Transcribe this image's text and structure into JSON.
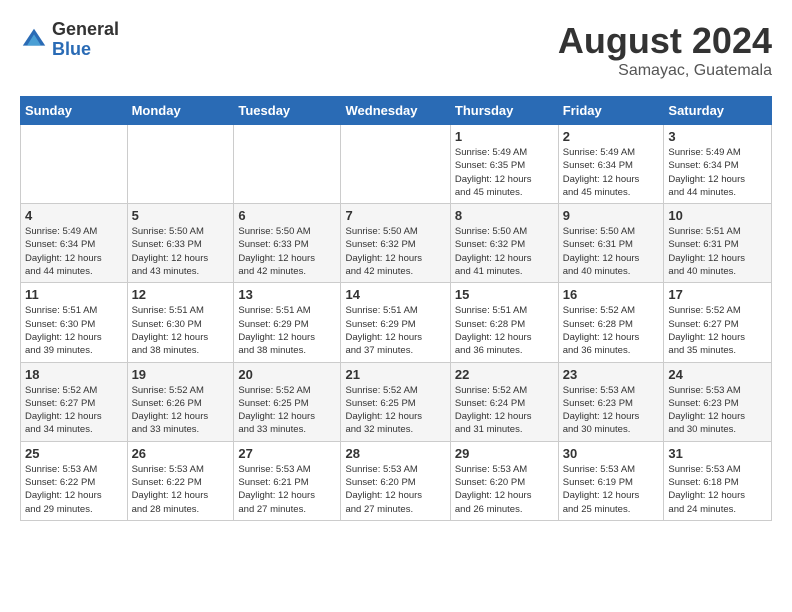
{
  "logo": {
    "general": "General",
    "blue": "Blue"
  },
  "header": {
    "month_year": "August 2024",
    "location": "Samayac, Guatemala"
  },
  "weekdays": [
    "Sunday",
    "Monday",
    "Tuesday",
    "Wednesday",
    "Thursday",
    "Friday",
    "Saturday"
  ],
  "weeks": [
    [
      {
        "day": "",
        "info": ""
      },
      {
        "day": "",
        "info": ""
      },
      {
        "day": "",
        "info": ""
      },
      {
        "day": "",
        "info": ""
      },
      {
        "day": "1",
        "info": "Sunrise: 5:49 AM\nSunset: 6:35 PM\nDaylight: 12 hours\nand 45 minutes."
      },
      {
        "day": "2",
        "info": "Sunrise: 5:49 AM\nSunset: 6:34 PM\nDaylight: 12 hours\nand 45 minutes."
      },
      {
        "day": "3",
        "info": "Sunrise: 5:49 AM\nSunset: 6:34 PM\nDaylight: 12 hours\nand 44 minutes."
      }
    ],
    [
      {
        "day": "4",
        "info": "Sunrise: 5:49 AM\nSunset: 6:34 PM\nDaylight: 12 hours\nand 44 minutes."
      },
      {
        "day": "5",
        "info": "Sunrise: 5:50 AM\nSunset: 6:33 PM\nDaylight: 12 hours\nand 43 minutes."
      },
      {
        "day": "6",
        "info": "Sunrise: 5:50 AM\nSunset: 6:33 PM\nDaylight: 12 hours\nand 42 minutes."
      },
      {
        "day": "7",
        "info": "Sunrise: 5:50 AM\nSunset: 6:32 PM\nDaylight: 12 hours\nand 42 minutes."
      },
      {
        "day": "8",
        "info": "Sunrise: 5:50 AM\nSunset: 6:32 PM\nDaylight: 12 hours\nand 41 minutes."
      },
      {
        "day": "9",
        "info": "Sunrise: 5:50 AM\nSunset: 6:31 PM\nDaylight: 12 hours\nand 40 minutes."
      },
      {
        "day": "10",
        "info": "Sunrise: 5:51 AM\nSunset: 6:31 PM\nDaylight: 12 hours\nand 40 minutes."
      }
    ],
    [
      {
        "day": "11",
        "info": "Sunrise: 5:51 AM\nSunset: 6:30 PM\nDaylight: 12 hours\nand 39 minutes."
      },
      {
        "day": "12",
        "info": "Sunrise: 5:51 AM\nSunset: 6:30 PM\nDaylight: 12 hours\nand 38 minutes."
      },
      {
        "day": "13",
        "info": "Sunrise: 5:51 AM\nSunset: 6:29 PM\nDaylight: 12 hours\nand 38 minutes."
      },
      {
        "day": "14",
        "info": "Sunrise: 5:51 AM\nSunset: 6:29 PM\nDaylight: 12 hours\nand 37 minutes."
      },
      {
        "day": "15",
        "info": "Sunrise: 5:51 AM\nSunset: 6:28 PM\nDaylight: 12 hours\nand 36 minutes."
      },
      {
        "day": "16",
        "info": "Sunrise: 5:52 AM\nSunset: 6:28 PM\nDaylight: 12 hours\nand 36 minutes."
      },
      {
        "day": "17",
        "info": "Sunrise: 5:52 AM\nSunset: 6:27 PM\nDaylight: 12 hours\nand 35 minutes."
      }
    ],
    [
      {
        "day": "18",
        "info": "Sunrise: 5:52 AM\nSunset: 6:27 PM\nDaylight: 12 hours\nand 34 minutes."
      },
      {
        "day": "19",
        "info": "Sunrise: 5:52 AM\nSunset: 6:26 PM\nDaylight: 12 hours\nand 33 minutes."
      },
      {
        "day": "20",
        "info": "Sunrise: 5:52 AM\nSunset: 6:25 PM\nDaylight: 12 hours\nand 33 minutes."
      },
      {
        "day": "21",
        "info": "Sunrise: 5:52 AM\nSunset: 6:25 PM\nDaylight: 12 hours\nand 32 minutes."
      },
      {
        "day": "22",
        "info": "Sunrise: 5:52 AM\nSunset: 6:24 PM\nDaylight: 12 hours\nand 31 minutes."
      },
      {
        "day": "23",
        "info": "Sunrise: 5:53 AM\nSunset: 6:23 PM\nDaylight: 12 hours\nand 30 minutes."
      },
      {
        "day": "24",
        "info": "Sunrise: 5:53 AM\nSunset: 6:23 PM\nDaylight: 12 hours\nand 30 minutes."
      }
    ],
    [
      {
        "day": "25",
        "info": "Sunrise: 5:53 AM\nSunset: 6:22 PM\nDaylight: 12 hours\nand 29 minutes."
      },
      {
        "day": "26",
        "info": "Sunrise: 5:53 AM\nSunset: 6:22 PM\nDaylight: 12 hours\nand 28 minutes."
      },
      {
        "day": "27",
        "info": "Sunrise: 5:53 AM\nSunset: 6:21 PM\nDaylight: 12 hours\nand 27 minutes."
      },
      {
        "day": "28",
        "info": "Sunrise: 5:53 AM\nSunset: 6:20 PM\nDaylight: 12 hours\nand 27 minutes."
      },
      {
        "day": "29",
        "info": "Sunrise: 5:53 AM\nSunset: 6:20 PM\nDaylight: 12 hours\nand 26 minutes."
      },
      {
        "day": "30",
        "info": "Sunrise: 5:53 AM\nSunset: 6:19 PM\nDaylight: 12 hours\nand 25 minutes."
      },
      {
        "day": "31",
        "info": "Sunrise: 5:53 AM\nSunset: 6:18 PM\nDaylight: 12 hours\nand 24 minutes."
      }
    ]
  ]
}
